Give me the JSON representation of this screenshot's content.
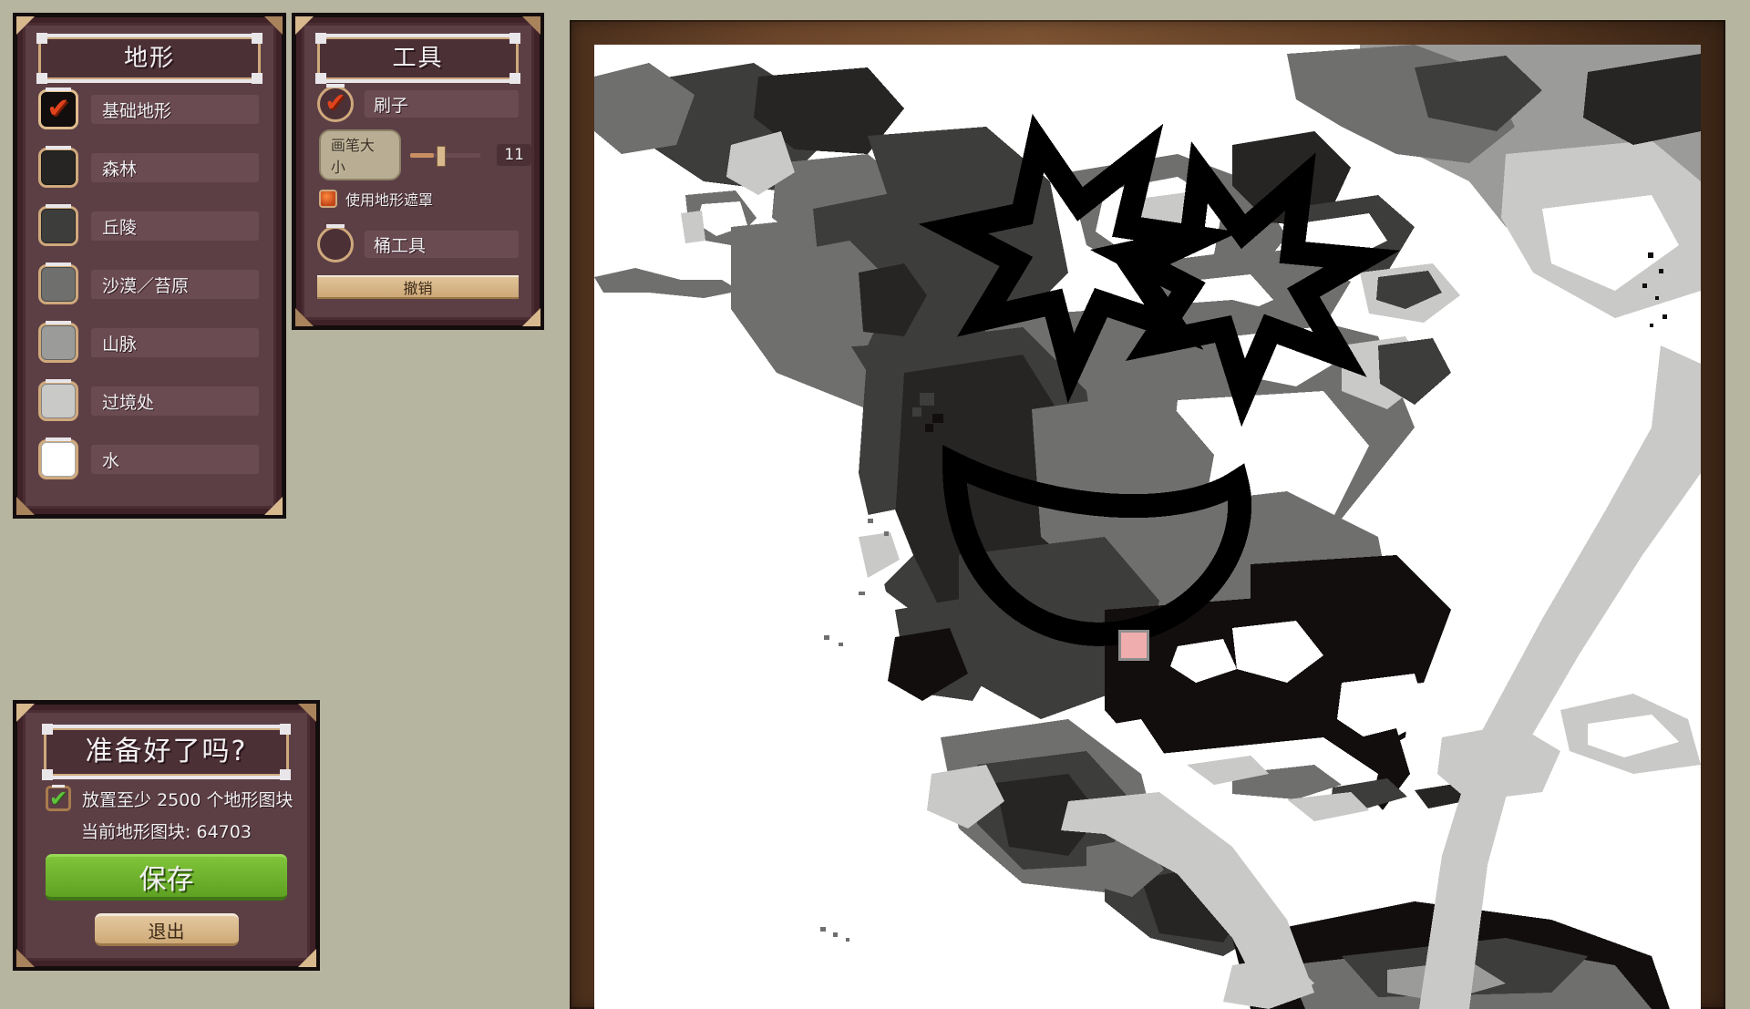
{
  "app": {
    "background_color": "#b6b5a0",
    "panel_color": "#5c3f45",
    "accent_gold": "#cfa97c"
  },
  "terrain_panel": {
    "title": "地形",
    "items": [
      {
        "label": "基础地形",
        "swatch": "#120e0e",
        "selected": true,
        "icon": "check-icon"
      },
      {
        "label": "森林",
        "swatch": "#262524",
        "selected": false,
        "icon": ""
      },
      {
        "label": "丘陵",
        "swatch": "#3d3d3c",
        "selected": false,
        "icon": ""
      },
      {
        "label": "沙漠／苔原",
        "swatch": "#6f6f6e",
        "selected": false,
        "icon": ""
      },
      {
        "label": "山脉",
        "swatch": "#9b9b9a",
        "selected": false,
        "icon": ""
      },
      {
        "label": "过境处",
        "swatch": "#c9c9c8",
        "selected": false,
        "icon": ""
      },
      {
        "label": "水",
        "swatch": "#ffffff",
        "selected": false,
        "icon": ""
      }
    ]
  },
  "tools_panel": {
    "title": "工具",
    "brush": {
      "label": "刷子",
      "selected": true,
      "icon": "check-icon",
      "size_label": "画笔大小",
      "size_value": "11",
      "mask_label": "使用地形遮罩",
      "mask_icon": "terrain-mask-icon",
      "mask_enabled": false
    },
    "bucket": {
      "label": "桶工具",
      "selected": false
    },
    "undo_label": "撤销"
  },
  "ready_panel": {
    "title": "准备好了吗?",
    "requirement_prefix": "放置至少",
    "requirement_amount": "2500",
    "requirement_suffix": "个地形图块",
    "requirement_met": true,
    "requirement_icon": "green-check-icon",
    "current_line": "当前地形图块: 64703",
    "save_label": "保存",
    "exit_label": "退出"
  },
  "map": {
    "cursor": {
      "name": "brush-cursor",
      "color": "#f0adad",
      "border": "#8d8d8d"
    },
    "palette": {
      "water": "#ffffff",
      "crossing": "#c9c9c8",
      "mountain": "#9b9b9a",
      "desert_tundra": "#6f6f6e",
      "hills": "#3d3d3c",
      "forest": "#262524",
      "base": "#120e0e",
      "drawing_ink": "#000000"
    },
    "drawing": "smiley face with two star eyes and an open mouth drawn over the Atlantic"
  }
}
